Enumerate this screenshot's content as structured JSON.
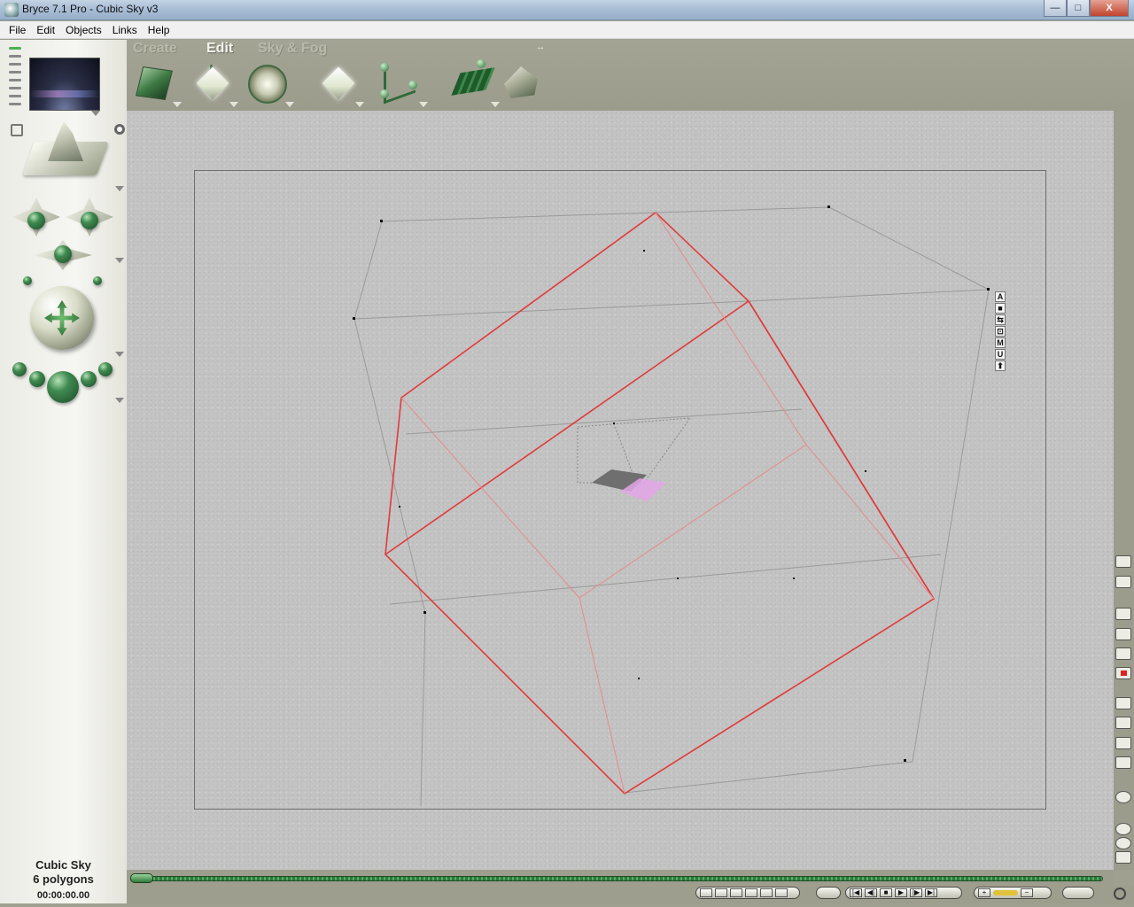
{
  "window": {
    "title": "Bryce 7.1  Pro - Cubic Sky v3",
    "minimize_label": "—",
    "maximize_label": "□",
    "close_label": "X"
  },
  "menu": {
    "items": [
      "File",
      "Edit",
      "Objects",
      "Links",
      "Help"
    ]
  },
  "toolbar": {
    "tabs": [
      {
        "label": "Create",
        "state": "inactive"
      },
      {
        "label": "Edit",
        "state": "active"
      },
      {
        "label": "Sky & Fog",
        "state": "inactive"
      }
    ],
    "tools": [
      "material-cube-icon",
      "resize-tool-icon",
      "rotate-tool-icon",
      "reposition-tool-icon",
      "align-tool-icon",
      "randomize-tool-icon",
      "terrain-editor-icon"
    ]
  },
  "selection": {
    "object_name": "Cubic Sky",
    "polygon_count": "6 polygons",
    "time": "00:00:00.00"
  },
  "view_strip": {
    "buttons": [
      "A",
      "■",
      "⇆",
      "⊡",
      "M",
      "U",
      "⬆"
    ]
  },
  "colors": {
    "selection_wire": "#e23a3a",
    "workspace": "#c3c3c3",
    "chrome": "#9fa08f"
  }
}
